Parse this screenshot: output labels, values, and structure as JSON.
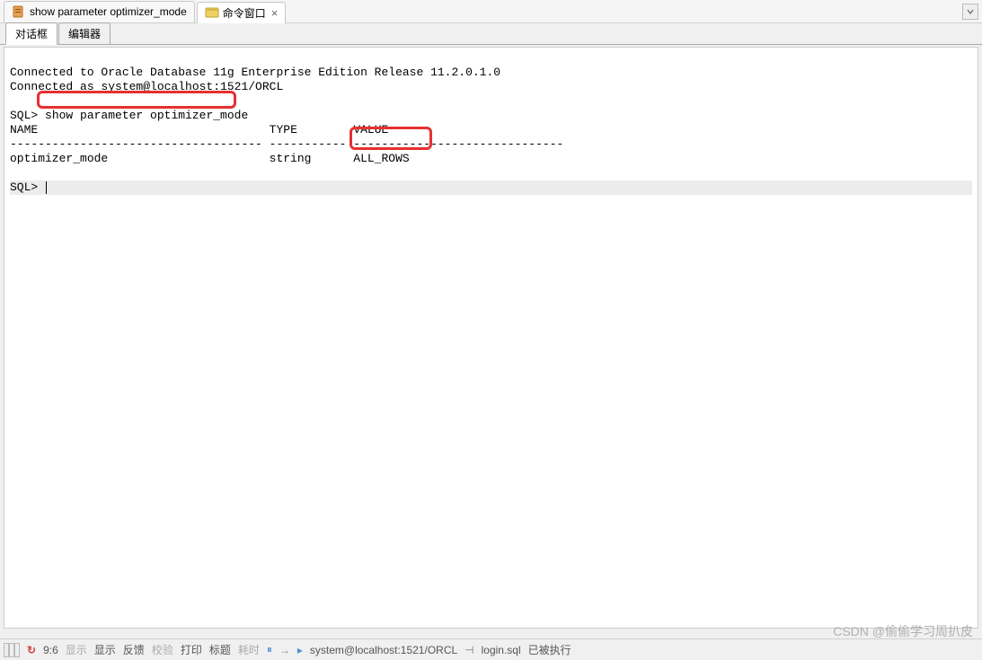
{
  "tabs": {
    "tab1": {
      "label": "show parameter optimizer_mode"
    },
    "tab2": {
      "label": "命令窗口"
    }
  },
  "subtabs": {
    "dialog": "对话框",
    "editor": "编辑器"
  },
  "terminal": {
    "line1": "Connected to Oracle Database 11g Enterprise Edition Release 11.2.0.1.0 ",
    "line2": "Connected as system@localhost:1521/ORCL",
    "prompt1": "SQL> ",
    "command1": "show parameter optimizer_mode",
    "header_name": "NAME",
    "header_type": "TYPE",
    "header_value": "VALUE",
    "sep": "------------------------------------ ----------- ------------------------------",
    "row_name": "optimizer_mode",
    "row_type": "string",
    "row_value": "ALL_ROWS",
    "prompt2": "SQL> "
  },
  "statusbar": {
    "position": "9:6",
    "s1": "显示",
    "s2": "显示",
    "s3": "反馈",
    "s4": "校验",
    "s5": "打印",
    "s6": "标题",
    "s7": "耗时",
    "connection": "system@localhost:1521/ORCL",
    "script": "login.sql",
    "status": "已被执行"
  },
  "watermark": "CSDN @偷偷学习周扒皮"
}
